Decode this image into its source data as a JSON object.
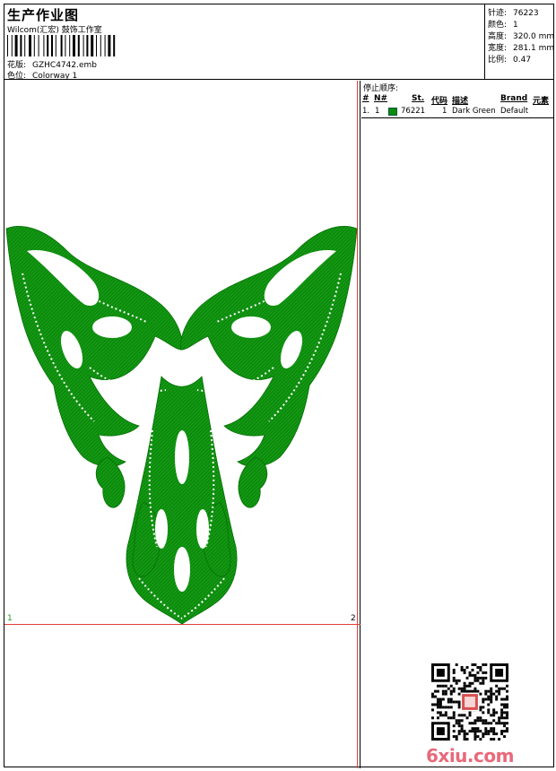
{
  "header": {
    "title": "生产作业图",
    "subtitle": "Wilcom(汇宏) 鼓饰工作室",
    "design_label": "花版:",
    "design_value": "GZHC4742.emb",
    "colorway_label": "色位:",
    "colorway_value": "Colorway 1"
  },
  "stats": [
    {
      "label": "针迹:",
      "value": "76223"
    },
    {
      "label": "颜色:",
      "value": "1"
    },
    {
      "label": "高度:",
      "value": "320.0 mm"
    },
    {
      "label": "宽度:",
      "value": "281.1 mm"
    },
    {
      "label": "比例:",
      "value": "0.47"
    }
  ],
  "canvas": {
    "corner_left": "1",
    "corner_right": "2",
    "embroidery_color": "#0a8c0a",
    "frame_color": "#e0403c"
  },
  "stop_sequence": {
    "title": "停止顺序:",
    "columns": {
      "hash": "#",
      "n": "N#",
      "st": "St.",
      "code": "代码",
      "desc": "描述",
      "brand": "Brand",
      "element": "元素"
    },
    "rows": [
      {
        "index": "1.",
        "n": "1",
        "stitches": "76221",
        "code": "1",
        "description": "Dark Green",
        "brand": "Default",
        "swatch": "#0a8c0a"
      }
    ]
  },
  "watermark": "6xiu.com"
}
